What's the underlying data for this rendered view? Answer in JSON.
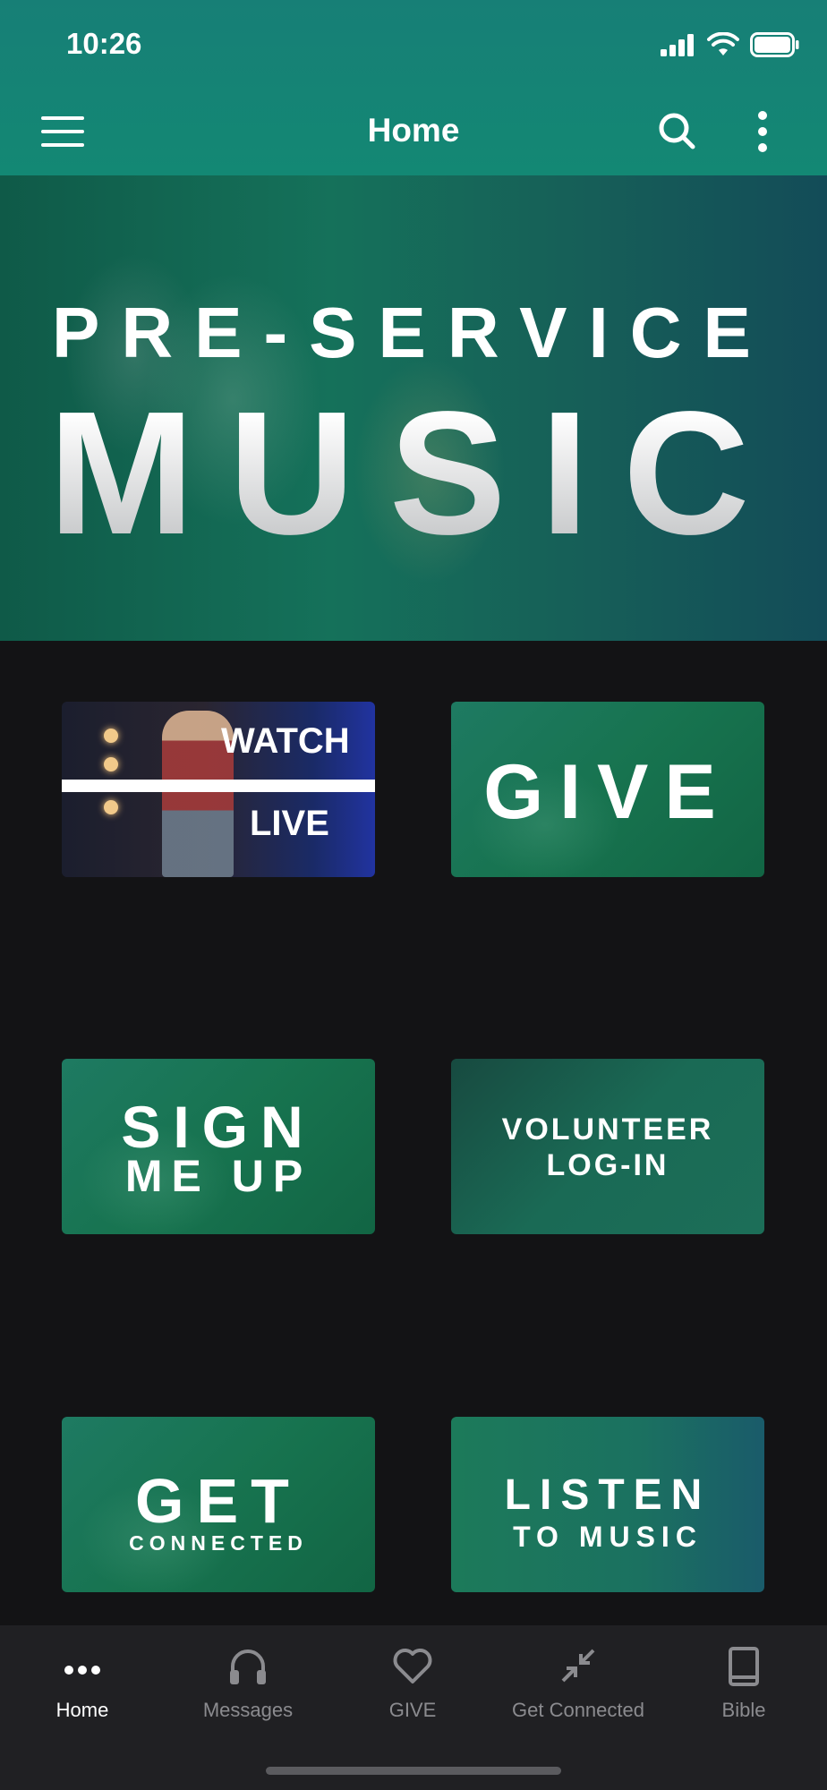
{
  "status_bar": {
    "time": "10:26"
  },
  "header": {
    "title": "Home"
  },
  "hero": {
    "line1": "PRE-SERVICE",
    "line2": "MUSIC"
  },
  "tiles": [
    {
      "line1": "WATCH",
      "line2": "LIVE"
    },
    {
      "line1": "GIVE"
    },
    {
      "line1": "SIGN",
      "line2": "ME UP"
    },
    {
      "line1": "VOLUNTEER",
      "line2": "LOG-IN"
    },
    {
      "line1": "GET",
      "line2": "CONNECTED"
    },
    {
      "line1": "LISTEN",
      "line2": "TO MUSIC"
    }
  ],
  "tabbar": {
    "items": [
      {
        "label": "Home",
        "icon": "more-dots-icon",
        "active": true
      },
      {
        "label": "Messages",
        "icon": "headphones-icon"
      },
      {
        "label": "GIVE",
        "icon": "heart-icon"
      },
      {
        "label": "Get Connected",
        "icon": "connect-arrows-icon"
      },
      {
        "label": "Bible",
        "icon": "book-icon"
      }
    ]
  },
  "colors": {
    "header": "#177f76",
    "background": "#131315",
    "tabbar": "#202023",
    "tile": "#1b7458"
  }
}
